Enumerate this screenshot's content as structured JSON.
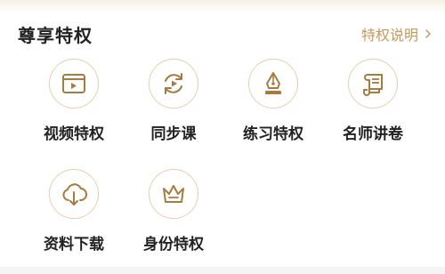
{
  "header": {
    "title": "尊享特权",
    "link_label": "特权说明"
  },
  "accent_color": "#c49a5a",
  "items": [
    {
      "label": "视频特权",
      "icon": "video-icon"
    },
    {
      "label": "同步课",
      "icon": "sync-play-icon"
    },
    {
      "label": "练习特权",
      "icon": "pen-nib-icon"
    },
    {
      "label": "名师讲卷",
      "icon": "scroll-icon"
    },
    {
      "label": "资料下载",
      "icon": "cloud-download-icon"
    },
    {
      "label": "身份特权",
      "icon": "crown-icon"
    }
  ]
}
